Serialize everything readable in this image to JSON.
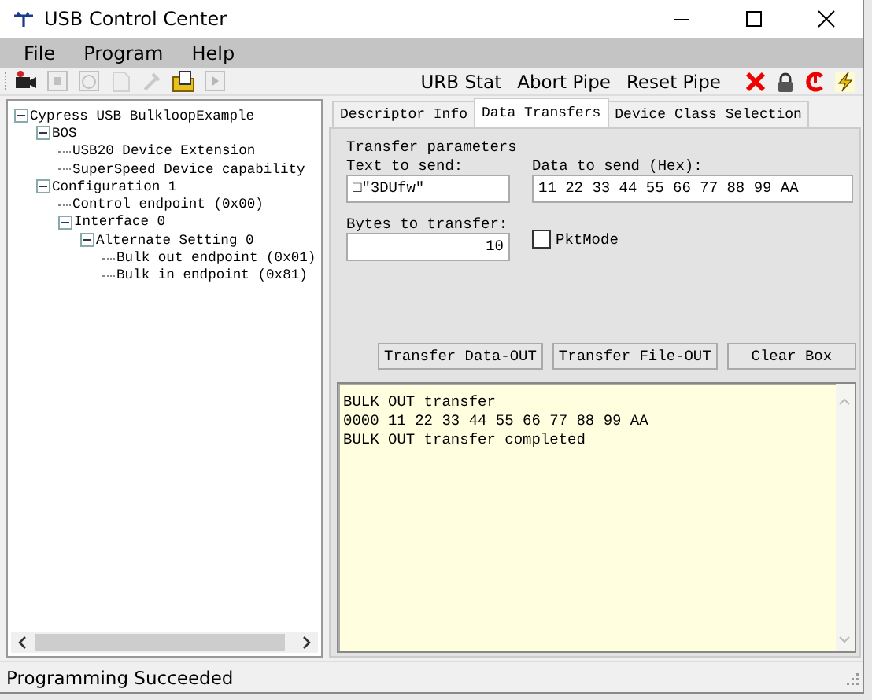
{
  "window": {
    "title": "USB Control Center"
  },
  "menu": [
    "File",
    "Program",
    "Help"
  ],
  "toolbar": {
    "icons": [
      {
        "kind": "camera",
        "disabled": false
      },
      {
        "kind": "stop",
        "disabled": true
      },
      {
        "kind": "clock",
        "disabled": true
      },
      {
        "kind": "page",
        "disabled": true
      },
      {
        "kind": "tool",
        "disabled": true
      },
      {
        "kind": "folder",
        "disabled": false
      },
      {
        "kind": "play",
        "disabled": true
      }
    ],
    "buttons": [
      "URB Stat",
      "Abort Pipe",
      "Reset Pipe"
    ],
    "right_icons": [
      {
        "kind": "cross"
      },
      {
        "kind": "lock"
      },
      {
        "kind": "reset"
      },
      {
        "kind": "bolt"
      }
    ]
  },
  "tree": [
    {
      "label": "Cypress USB BulkloopExample",
      "expanded": true,
      "children": [
        {
          "label": "BOS",
          "expanded": true,
          "children": [
            {
              "label": "USB20 Device Extension"
            },
            {
              "label": "SuperSpeed Device capability"
            }
          ]
        },
        {
          "label": "Configuration 1",
          "expanded": true,
          "children": [
            {
              "label": "Control endpoint (0x00)"
            },
            {
              "label": "Interface 0",
              "expanded": true,
              "children": [
                {
                  "label": "Alternate Setting 0",
                  "expanded": true,
                  "children": [
                    {
                      "label": "Bulk out endpoint (0x01)"
                    },
                    {
                      "label": "Bulk in endpoint (0x81)"
                    }
                  ]
                }
              ]
            }
          ]
        }
      ]
    }
  ],
  "tabs": [
    {
      "label": "Descriptor Info",
      "selected": false
    },
    {
      "label": "Data Transfers",
      "selected": true
    },
    {
      "label": "Device Class Selection",
      "selected": false
    }
  ],
  "transfer": {
    "group_label": "Transfer parameters",
    "text_label": "Text to send:",
    "text_value": "□\"3DUfw\"",
    "hex_label": "Data to send (Hex):",
    "hex_value": "11 22 33 44 55 66 77 88 99 AA",
    "bytes_label": "Bytes to transfer:",
    "bytes_value": "10",
    "pkt_mode": {
      "label": "PktMode",
      "checked": false
    }
  },
  "buttons": [
    "Transfer Data-OUT",
    "Transfer File-OUT",
    "Clear Box"
  ],
  "output": [
    "BULK OUT transfer",
    "0000 11 22 33 44 55 66 77 88 99 AA",
    "BULK OUT transfer completed"
  ],
  "status_bar": "Programming Succeeded"
}
